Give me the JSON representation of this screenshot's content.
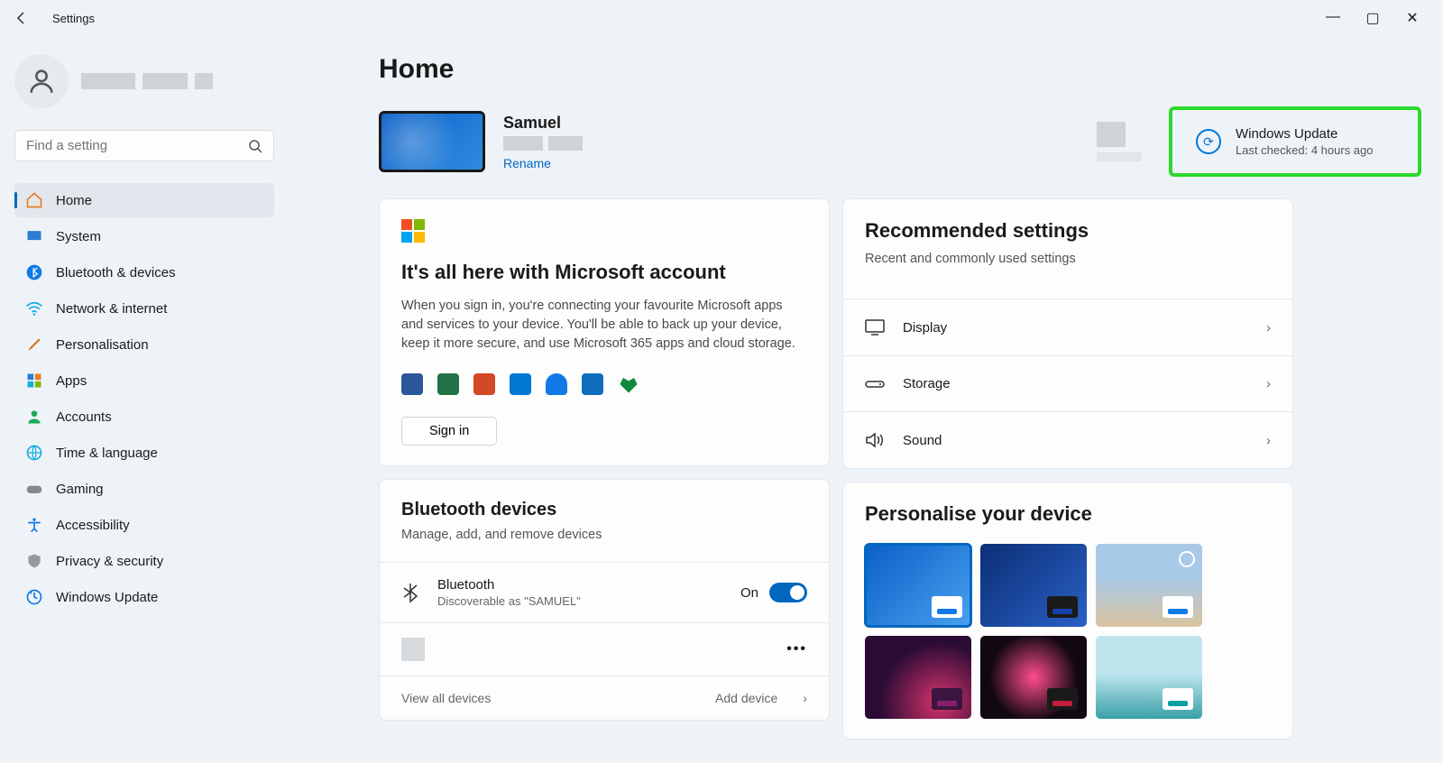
{
  "window": {
    "title": "Settings"
  },
  "search": {
    "placeholder": "Find a setting"
  },
  "nav": {
    "items": [
      {
        "label": "Home"
      },
      {
        "label": "System"
      },
      {
        "label": "Bluetooth & devices"
      },
      {
        "label": "Network & internet"
      },
      {
        "label": "Personalisation"
      },
      {
        "label": "Apps"
      },
      {
        "label": "Accounts"
      },
      {
        "label": "Time & language"
      },
      {
        "label": "Gaming"
      },
      {
        "label": "Accessibility"
      },
      {
        "label": "Privacy & security"
      },
      {
        "label": "Windows Update"
      }
    ]
  },
  "page": {
    "title": "Home"
  },
  "device": {
    "name": "Samuel",
    "rename": "Rename"
  },
  "windows_update": {
    "title": "Windows Update",
    "subtitle": "Last checked: 4 hours ago"
  },
  "ms_account": {
    "heading": "It's all here with Microsoft account",
    "body": "When you sign in, you're connecting your favourite Microsoft apps and services to your device. You'll be able to back up your device, keep it more secure, and use Microsoft 365 apps and cloud storage.",
    "signin": "Sign in"
  },
  "bluetooth": {
    "heading": "Bluetooth devices",
    "sub": "Manage, add, and remove devices",
    "row_title": "Bluetooth",
    "row_desc": "Discoverable as \"SAMUEL\"",
    "state": "On",
    "view_all": "View all devices",
    "add": "Add device"
  },
  "recommended": {
    "heading": "Recommended settings",
    "sub": "Recent and commonly used settings",
    "items": [
      {
        "label": "Display"
      },
      {
        "label": "Storage"
      },
      {
        "label": "Sound"
      }
    ]
  },
  "personalise": {
    "heading": "Personalise your device"
  },
  "themes": {
    "colors": [
      "#1c6dd0",
      "#0b2f75",
      "#c9b79a",
      "#2a0b34",
      "#120812",
      "#7ab8c9"
    ],
    "accent": [
      "#0f7ae5",
      "#1740a8",
      "#e0a050",
      "#8a1e6e",
      "#c41c3d",
      "#0aa0a0"
    ]
  }
}
